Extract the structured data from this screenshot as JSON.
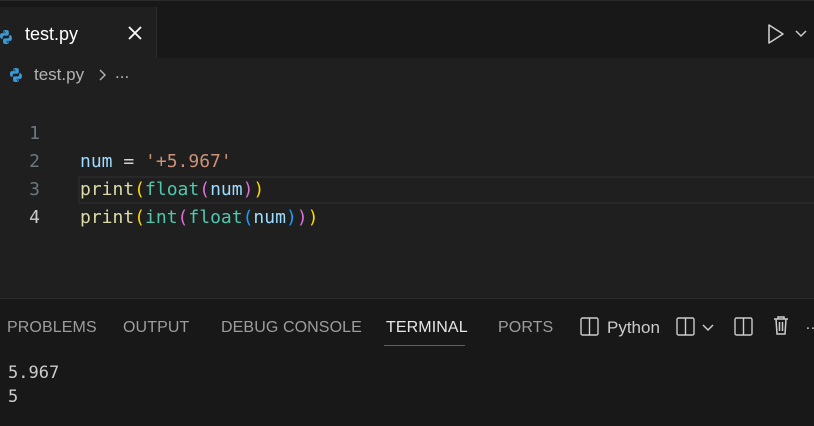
{
  "tab": {
    "filename": "test.py",
    "icon": "python-icon",
    "close_icon": "close-icon"
  },
  "toolbar": {
    "run_icon": "run-icon",
    "run_menu_icon": "chevron-down-icon"
  },
  "breadcrumb": {
    "file": "test.py",
    "more": "..."
  },
  "editor": {
    "line_numbers": [
      "1",
      "2",
      "3",
      "4"
    ],
    "lines": [
      {
        "tokens": [
          "num",
          " = ",
          "'+5.967'"
        ]
      },
      {
        "tokens": [
          "print",
          "(",
          "float",
          "(",
          "num",
          ")",
          ")"
        ]
      },
      {
        "tokens": [
          "print",
          "(",
          "int",
          "(",
          "float",
          "(",
          "num",
          ")",
          ")",
          ")"
        ]
      },
      {
        "tokens": [
          ""
        ]
      }
    ],
    "active_line": 4
  },
  "panel": {
    "tabs": [
      "PROBLEMS",
      "OUTPUT",
      "DEBUG CONSOLE",
      "TERMINAL",
      "PORTS"
    ],
    "active_tab": "TERMINAL",
    "terminal_name": "Python",
    "output": [
      "5.967",
      "5"
    ]
  },
  "colors": {
    "background": "#1f1f1f",
    "accent": "#0078d4",
    "string": "#ce9178",
    "variable": "#9cdcfe",
    "function": "#dcdcaa",
    "class": "#4ec9b0"
  }
}
